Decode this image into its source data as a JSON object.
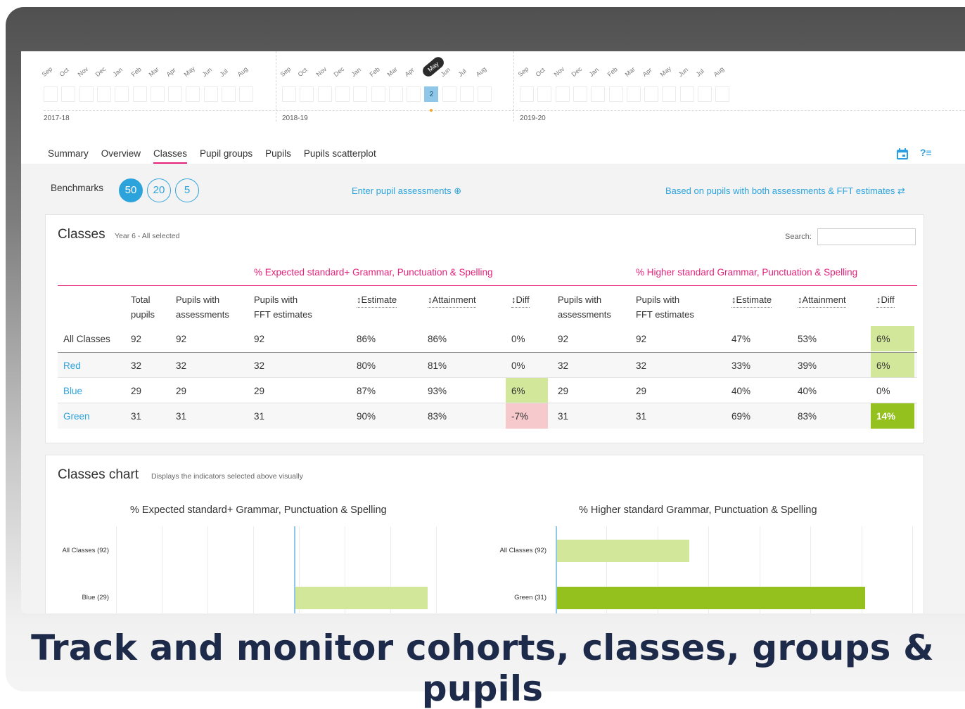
{
  "timeline": {
    "months": [
      "Sep",
      "Oct",
      "Nov",
      "Dec",
      "Jan",
      "Feb",
      "Mar",
      "Apr",
      "May",
      "Jun",
      "Jul",
      "Aug"
    ],
    "years": [
      "2017-18",
      "2018-19",
      "2019-20"
    ],
    "selected_year_index": 1,
    "selected_month": "May",
    "selected_count": "2"
  },
  "nav": {
    "tabs": [
      "Summary",
      "Overview",
      "Classes",
      "Pupil groups",
      "Pupils",
      "Pupils scatterplot"
    ],
    "active_tab": "Classes"
  },
  "benchmarks": {
    "label": "Benchmarks",
    "options": [
      "50",
      "20",
      "5"
    ],
    "selected": "50"
  },
  "links": {
    "enter_assessments": "Enter pupil assessments ⊕",
    "based_on": "Based on pupils with both assessments & FFT estimates ⇄"
  },
  "classes": {
    "title": "Classes",
    "subtitle": "Year 6 - All selected",
    "search_label": "Search:",
    "search_value": "",
    "group_headers": [
      "% Expected standard+ Grammar, Punctuation & Spelling",
      "% Higher standard Grammar, Punctuation & Spelling"
    ],
    "columns": [
      [
        "Total",
        "pupils"
      ],
      [
        "Pupils with",
        "assessments"
      ],
      [
        "Pupils with",
        "FFT estimates"
      ],
      [
        "Estimate"
      ],
      [
        "Attainment"
      ],
      [
        "Diff"
      ],
      [
        "Pupils with",
        "assessments"
      ],
      [
        "Pupils with",
        "FFT estimates"
      ],
      [
        "Estimate"
      ],
      [
        "Attainment"
      ],
      [
        "Diff"
      ]
    ],
    "rows": [
      {
        "name": "All Classes",
        "link": false,
        "values": [
          "92",
          "92",
          "92",
          "86%",
          "86%",
          "0%",
          "92",
          "92",
          "47%",
          "53%",
          "6%"
        ],
        "highlight": {
          "10": "light"
        }
      },
      {
        "name": "Red",
        "link": true,
        "values": [
          "32",
          "32",
          "32",
          "80%",
          "81%",
          "0%",
          "32",
          "32",
          "33%",
          "39%",
          "6%"
        ],
        "highlight": {
          "10": "light"
        }
      },
      {
        "name": "Blue",
        "link": true,
        "values": [
          "29",
          "29",
          "29",
          "87%",
          "93%",
          "6%",
          "29",
          "29",
          "40%",
          "40%",
          "0%"
        ],
        "highlight": {
          "5": "light"
        }
      },
      {
        "name": "Green",
        "link": true,
        "values": [
          "31",
          "31",
          "31",
          "90%",
          "83%",
          "-7%",
          "31",
          "31",
          "69%",
          "83%",
          "14%"
        ],
        "highlight": {
          "5": "red",
          "10": "dark"
        }
      }
    ],
    "colors": {
      "pink": "#e5227b",
      "light_green": "#d3e79b",
      "dark_green": "#95c11f",
      "red": "#f6c9cc",
      "blue": "#2da3dc"
    }
  },
  "chart": {
    "title": "Classes chart",
    "subtitle": "Displays the indicators selected above visually"
  },
  "chart_data": [
    {
      "type": "bar",
      "title": "% Expected standard+ Grammar, Punctuation & Spelling",
      "categories": [
        "All Classes (92)",
        "Blue (29)"
      ],
      "values": [
        0,
        6
      ]
    },
    {
      "type": "bar",
      "title": "% Higher standard Grammar, Punctuation & Spelling",
      "categories": [
        "All Classes (92)",
        "Green (31)"
      ],
      "values": [
        6,
        14
      ]
    }
  ],
  "caption": "Track and monitor cohorts, classes, groups & pupils"
}
